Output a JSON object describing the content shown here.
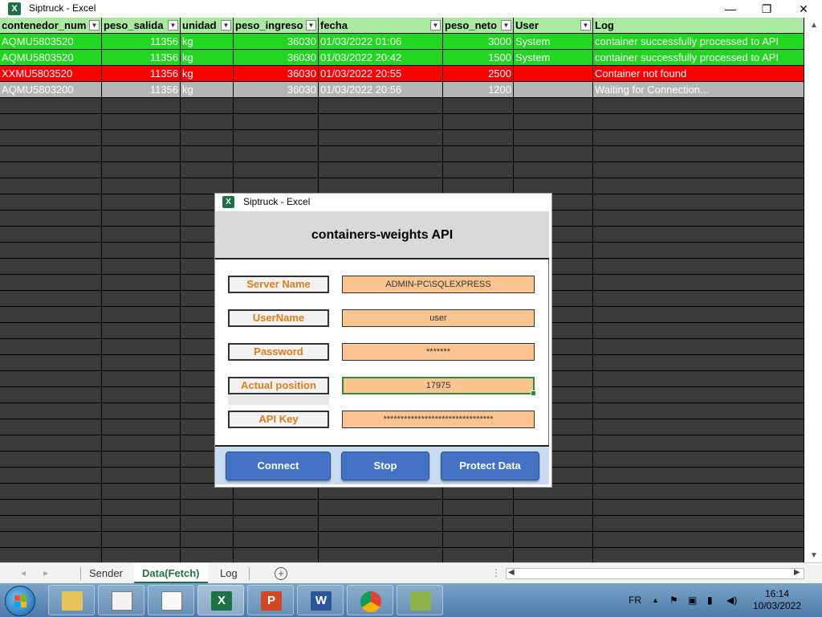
{
  "window": {
    "title": "Siptruck - Excel",
    "logo_letter": "X",
    "min_glyph": "—",
    "restore_glyph": "❐",
    "close_glyph": "✕"
  },
  "table": {
    "headers": [
      "contenedor_num",
      "peso_salida",
      "unidad",
      "peso_ingreso",
      "fecha",
      "peso_neto",
      "User",
      "Log"
    ],
    "rows": [
      {
        "status": "green",
        "cells": [
          "AQMU5803520",
          "11356",
          "kg",
          "36030",
          "01/03/2022 01:06",
          "3000",
          "System",
          "container successfully processed to API"
        ]
      },
      {
        "status": "green",
        "cells": [
          "AQMU5803520",
          "11356",
          "kg",
          "36030",
          "01/03/2022 20:42",
          "1500",
          "System",
          "container successfully processed to API"
        ]
      },
      {
        "status": "red",
        "cells": [
          "XXMU5803520",
          "11356",
          "kg",
          "36030",
          "01/03/2022 20:55",
          "2500",
          "",
          "Container not found"
        ]
      },
      {
        "status": "gray",
        "cells": [
          "AQMU5803200",
          "11356",
          "kg",
          "36030",
          "01/03/2022 20:56",
          "1200",
          "",
          "Waiting for Connection..."
        ]
      }
    ]
  },
  "dialog": {
    "title": "Siptruck - Excel",
    "heading": "containers-weights API",
    "fields": [
      {
        "label": "Server Name",
        "value": "ADMIN-PC\\SQLEXPRESS"
      },
      {
        "label": "UserName",
        "value": "user"
      },
      {
        "label": "Password",
        "value": "*******"
      },
      {
        "label": "Actual position",
        "value": "17975"
      },
      {
        "label": "API Key",
        "value": "********************************"
      }
    ],
    "buttons": {
      "connect": "Connect",
      "stop": "Stop",
      "protect": "Protect Data"
    }
  },
  "sheet_tabs": {
    "tabs": [
      "Sender",
      "Data(Fetch)",
      "Log"
    ],
    "active": "Data(Fetch)",
    "add_glyph": "+"
  },
  "taskbar": {
    "language": "FR",
    "time": "16:14",
    "date": "10/03/2022"
  },
  "colors": {
    "header_green": "#a9e9a0",
    "row_success": "#22d622",
    "row_error": "#ff0000",
    "row_waiting": "#b5b5b5",
    "field_orange": "#f9c48f",
    "label_text": "#e07b1a",
    "button_blue": "#4472c4"
  }
}
